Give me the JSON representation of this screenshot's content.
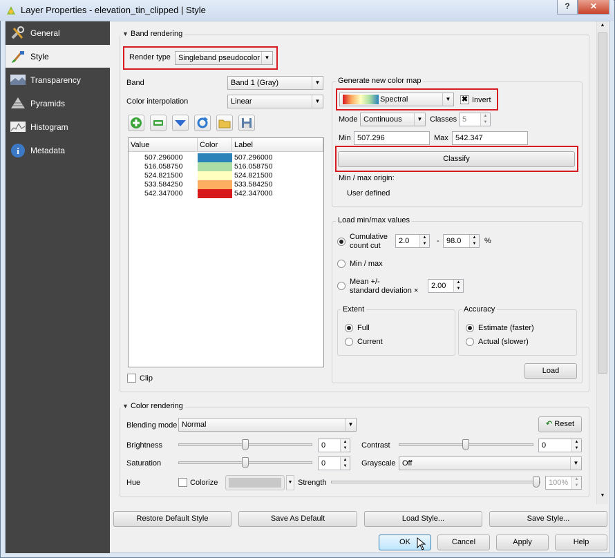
{
  "window": {
    "title": "Layer Properties - elevation_tin_clipped | Style",
    "help_btn": "?",
    "close_btn": "✕"
  },
  "sidebar": {
    "items": [
      {
        "label": "General",
        "icon": "wrench-icon"
      },
      {
        "label": "Style",
        "icon": "brush-icon"
      },
      {
        "label": "Transparency",
        "icon": "transparency-icon"
      },
      {
        "label": "Pyramids",
        "icon": "pyramids-icon"
      },
      {
        "label": "Histogram",
        "icon": "histogram-icon"
      },
      {
        "label": "Metadata",
        "icon": "info-icon"
      }
    ]
  },
  "band_rendering": {
    "title": "Band rendering",
    "render_type_label": "Render type",
    "render_type_value": "Singleband pseudocolor",
    "band_label": "Band",
    "band_value": "Band 1 (Gray)",
    "interp_label": "Color interpolation",
    "interp_value": "Linear",
    "table": {
      "headers": [
        "Value",
        "Color",
        "Label"
      ],
      "rows": [
        {
          "value": "507.296000",
          "color": "#2b83ba",
          "label": "507.296000"
        },
        {
          "value": "516.058750",
          "color": "#abdda4",
          "label": "516.058750"
        },
        {
          "value": "524.821500",
          "color": "#ffffbf",
          "label": "524.821500"
        },
        {
          "value": "533.584250",
          "color": "#fdae61",
          "label": "533.584250"
        },
        {
          "value": "542.347000",
          "color": "#d7191c",
          "label": "542.347000"
        }
      ]
    },
    "clip_label": "Clip",
    "gen": {
      "title": "Generate new color map",
      "ramp": "Spectral",
      "invert_label": "Invert",
      "invert_checked": true,
      "mode_label": "Mode",
      "mode_value": "Continuous",
      "classes_label": "Classes",
      "classes_value": "5",
      "min_label": "Min",
      "min_value": "507.296",
      "max_label": "Max",
      "max_value": "542.347",
      "classify": "Classify",
      "origin_label": "Min / max origin:",
      "origin_value": "User defined"
    },
    "minmax": {
      "title": "Load min/max values",
      "cumulative": "Cumulative",
      "count_cut": "count cut",
      "cum_low": "2.0",
      "dash": "-",
      "cum_high": "98.0",
      "pct": "%",
      "minmax": "Min / max",
      "mean": "Mean +/-",
      "stddev": "standard deviation ×",
      "stddev_value": "2.00",
      "extent_title": "Extent",
      "full": "Full",
      "current": "Current",
      "accuracy_title": "Accuracy",
      "estimate": "Estimate (faster)",
      "actual": "Actual (slower)",
      "load": "Load"
    }
  },
  "color_rendering": {
    "title": "Color rendering",
    "blend_label": "Blending mode",
    "blend_value": "Normal",
    "reset": "Reset",
    "brightness_label": "Brightness",
    "brightness_value": "0",
    "contrast_label": "Contrast",
    "contrast_value": "0",
    "saturation_label": "Saturation",
    "saturation_value": "0",
    "grayscale_label": "Grayscale",
    "grayscale_value": "Off",
    "hue_label": "Hue",
    "colorize_label": "Colorize",
    "strength_label": "Strength",
    "strength_value": "100%"
  },
  "style_buttons": [
    "Restore Default Style",
    "Save As Default",
    "Load Style...",
    "Save Style..."
  ],
  "dialog_buttons": {
    "ok": "OK",
    "cancel": "Cancel",
    "apply": "Apply",
    "help": "Help"
  }
}
